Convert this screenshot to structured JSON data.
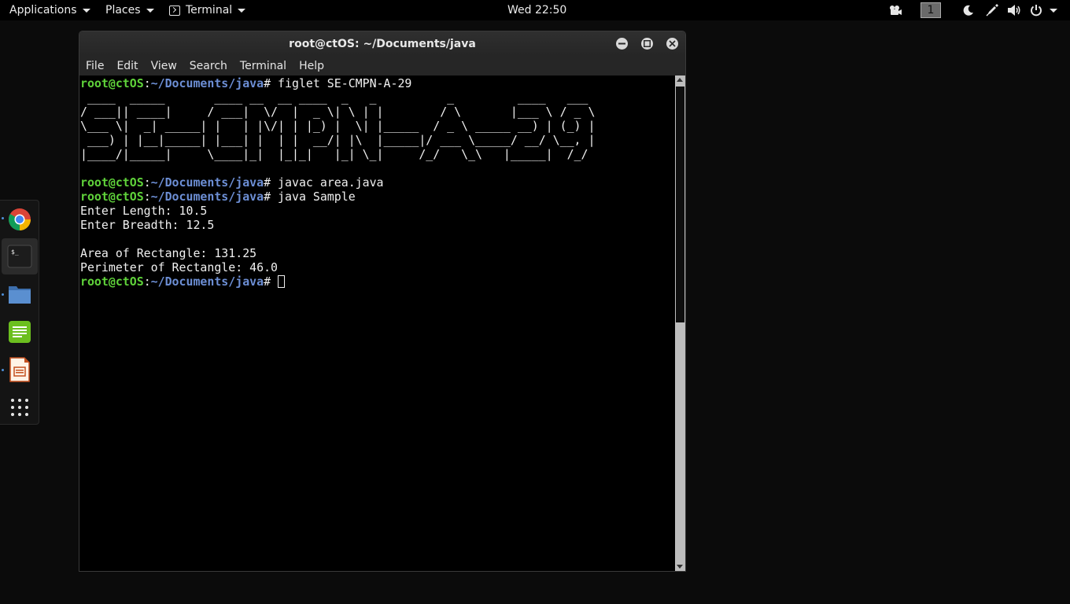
{
  "top_panel": {
    "applications_label": "Applications",
    "places_label": "Places",
    "terminal_label": "Terminal",
    "clock": "Wed 22:50",
    "workspace_number": "1"
  },
  "dock": {
    "items": [
      {
        "icon": "chrome-icon",
        "running": true
      },
      {
        "icon": "terminal-icon",
        "running": true,
        "active": true
      },
      {
        "icon": "files-icon",
        "running": true
      },
      {
        "icon": "text-editor-icon",
        "running": false
      },
      {
        "icon": "libreoffice-impress-icon",
        "running": true
      },
      {
        "icon": "app-grid-icon",
        "running": false
      }
    ]
  },
  "window": {
    "title": "root@ctOS: ~/Documents/java",
    "menu": [
      "File",
      "Edit",
      "View",
      "Search",
      "Terminal",
      "Help"
    ]
  },
  "terminal": {
    "prompt_user": "root@ctOS",
    "prompt_path": "~/Documents/java",
    "prompt_symbol": "#",
    "commands": [
      " figlet SE-CMPN-A-29",
      " javac area.java",
      " java Sample",
      " "
    ],
    "figlet_lines": [
      " ____  _____       ____ __  __ ____  _   _          _         ____   ___  ",
      "/ ___|| ____|     / ___|  \\/  |  _ \\| \\ | |        / \\       |___ \\ / _ \\ ",
      "\\___ \\|  _| _____| |   | |\\/| | |_) |  \\| |_____  / _ \\ _____ __) | (_) |",
      " ___) | |__|_____| |___| |  | |  __/| |\\  |_____|/ ___ \\_____/ __/ \\__, |",
      "|____/|_____|     \\____|_|  |_|_|   |_| \\_|     /_/   \\_\\   |_____|  /_/ "
    ],
    "output": {
      "enter_length": "Enter Length: 10.5",
      "enter_breadth": "Enter Breadth: 12.5",
      "area": "Area of Rectangle: 131.25",
      "perimeter": "Perimeter of Rectangle: 46.0"
    }
  },
  "colors": {
    "prompt_user": "#5fd23a",
    "prompt_path": "#6c8ed4",
    "terminal_bg": "#000000",
    "desktop_bg": "#0b0b0b"
  }
}
